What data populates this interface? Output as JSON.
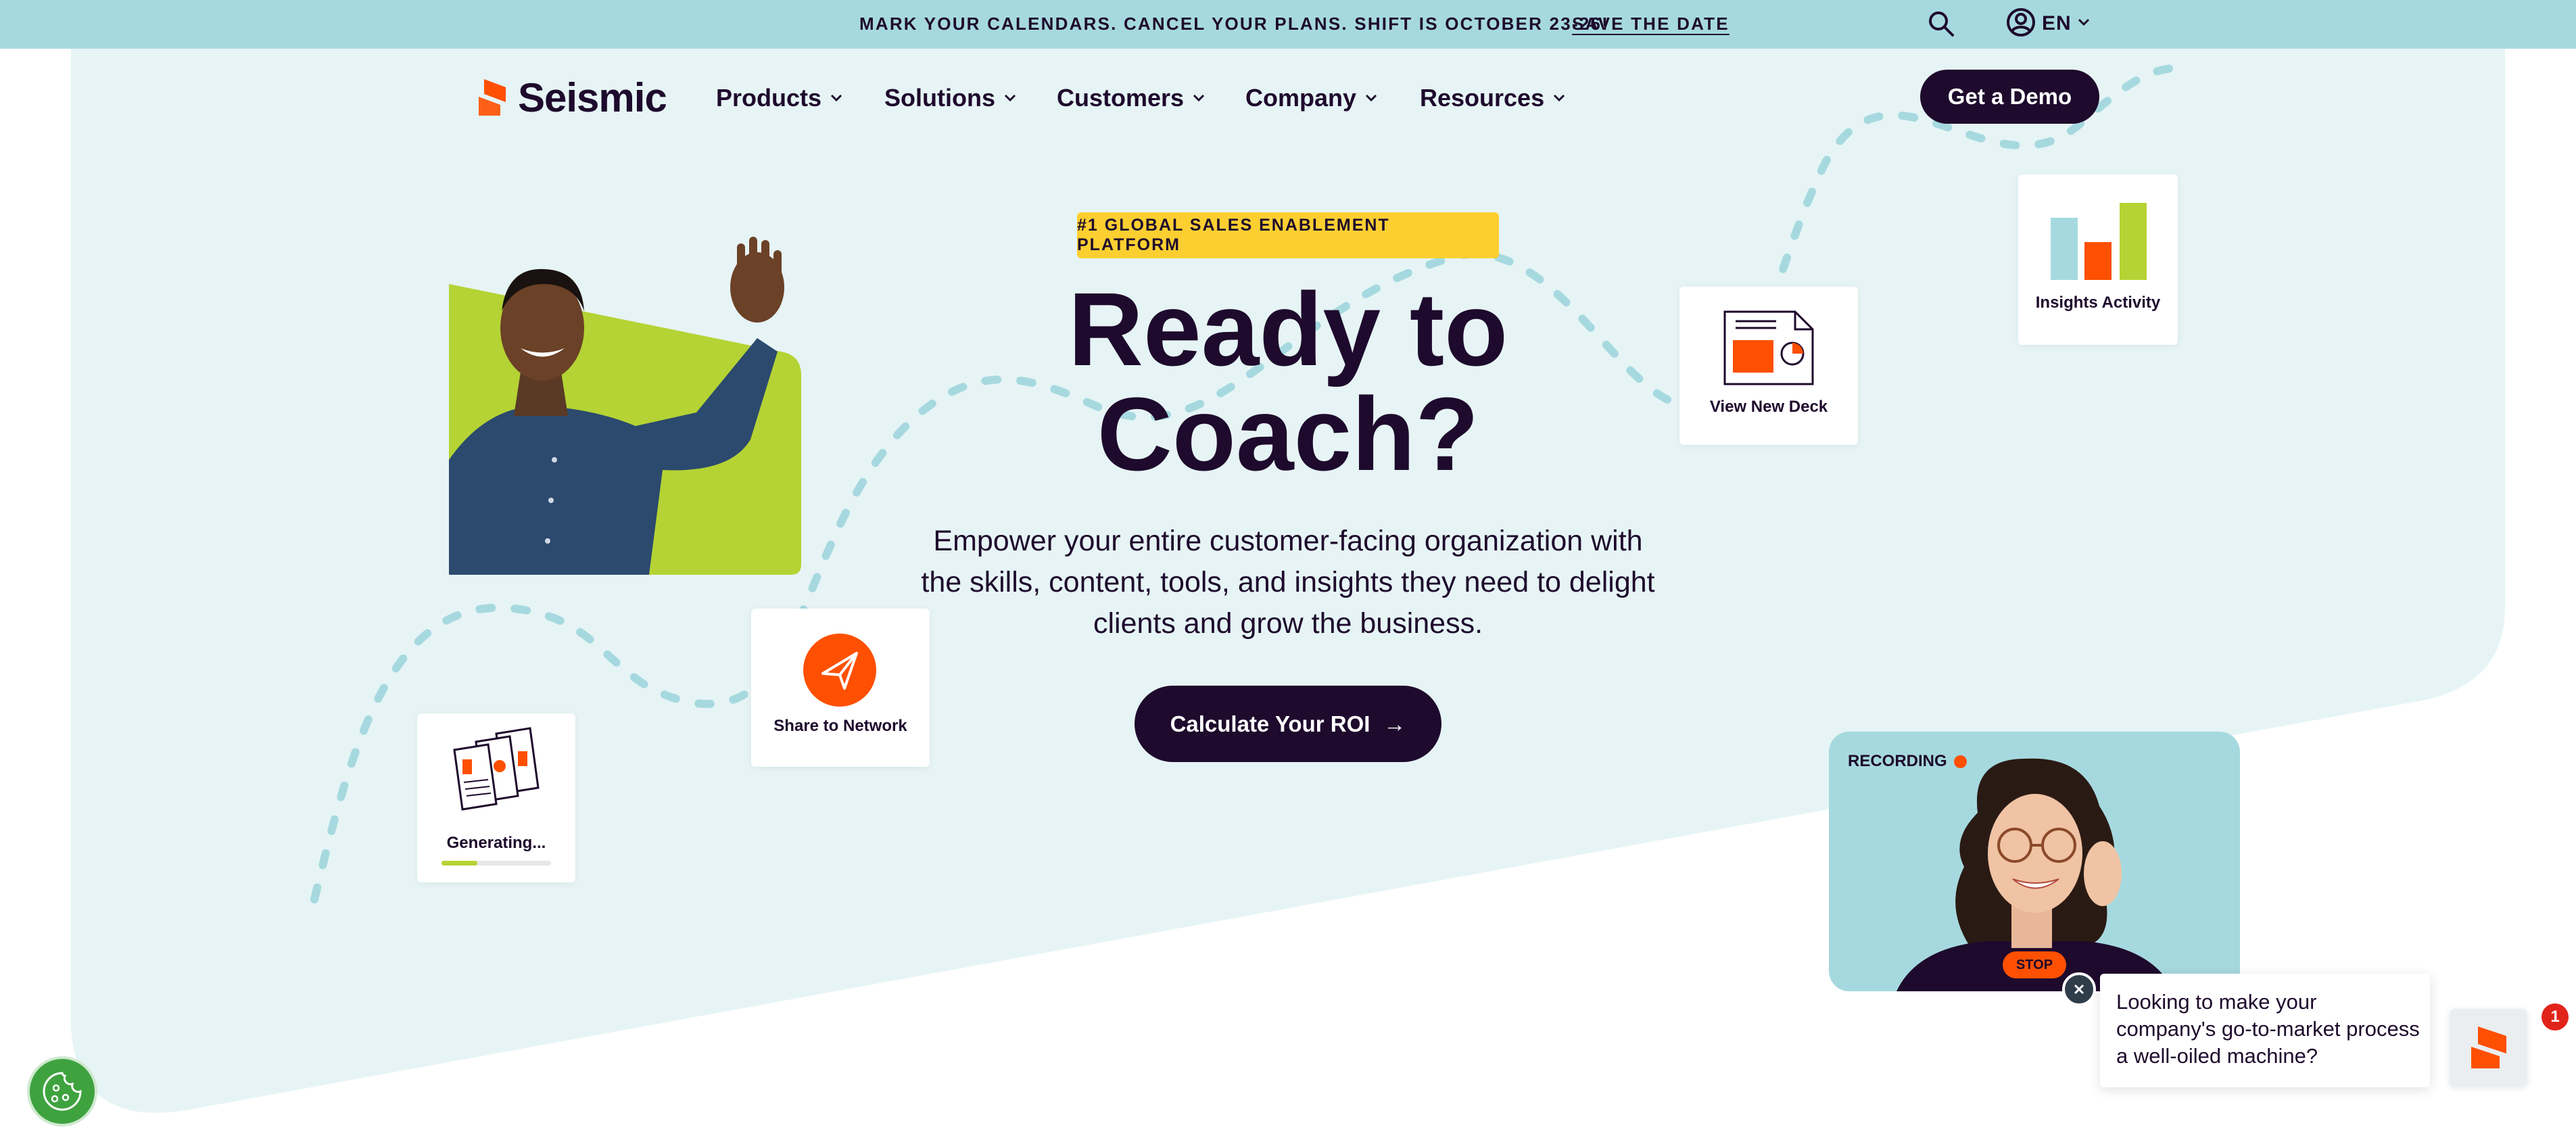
{
  "announcement": {
    "message": "MARK YOUR CALENDARS. CANCEL YOUR PLANS. SHIFT IS OCTOBER 23-26!",
    "link_label": "SAVE THE DATE"
  },
  "utility": {
    "search_icon": "search-icon",
    "language": "EN"
  },
  "nav": {
    "brand": "Seismic",
    "items": [
      {
        "label": "Products"
      },
      {
        "label": "Solutions"
      },
      {
        "label": "Customers"
      },
      {
        "label": "Company"
      },
      {
        "label": "Resources"
      }
    ],
    "cta": "Get a Demo"
  },
  "hero": {
    "badge": "#1 GLOBAL SALES ENABLEMENT PLATFORM",
    "headline_line1": "Ready to",
    "headline_line2": "Coach?",
    "subtext": "Empower your entire customer-facing organization with the skills, content, tools, and insights they need to delight clients and grow the business.",
    "cta": "Calculate Your ROI",
    "cta_icon": "→"
  },
  "cards": {
    "share": {
      "label": "Share to Network",
      "icon": "paper-plane-icon"
    },
    "deck": {
      "label": "View New Deck",
      "icon": "document-icon"
    },
    "insights": {
      "label": "Insights Activity",
      "icon": "bar-chart-icon"
    },
    "generating": {
      "label": "Generating...",
      "icon": "documents-icon",
      "progress": 0.33
    }
  },
  "recording": {
    "label": "RECORDING",
    "stop_label": "STOP"
  },
  "chat": {
    "message": "Looking to make your company's go-to-market process a well-oiled machine?",
    "badge_count": "1"
  },
  "colors": {
    "brand_dark": "#1e0a2c",
    "brand_orange": "#fe5000",
    "lime": "#b5d334",
    "light_teal": "#e6f4f5",
    "teal": "#a6d9df",
    "yellow": "#fccf31"
  }
}
